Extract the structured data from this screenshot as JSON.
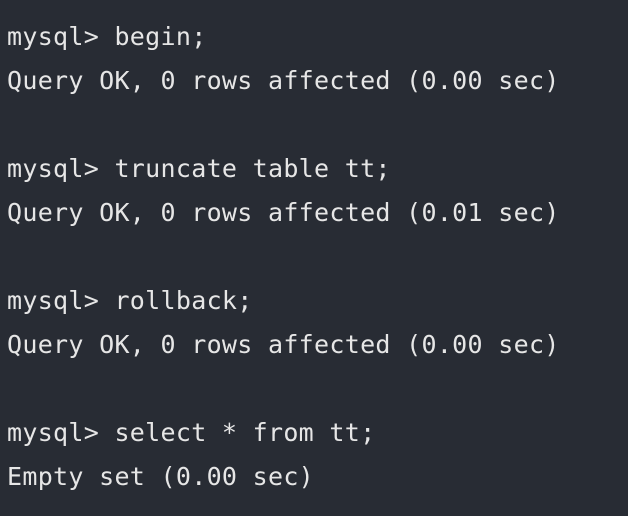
{
  "terminal": {
    "lines": [
      "mysql> begin;",
      "Query OK, 0 rows affected (0.00 sec)",
      "",
      "mysql> truncate table tt;",
      "Query OK, 0 rows affected (0.01 sec)",
      "",
      "mysql> rollback;",
      "Query OK, 0 rows affected (0.00 sec)",
      "",
      "mysql> select * from tt;",
      "Empty set (0.00 sec)"
    ]
  },
  "colors": {
    "background": "#282c34",
    "text": "#e6e6e6"
  }
}
